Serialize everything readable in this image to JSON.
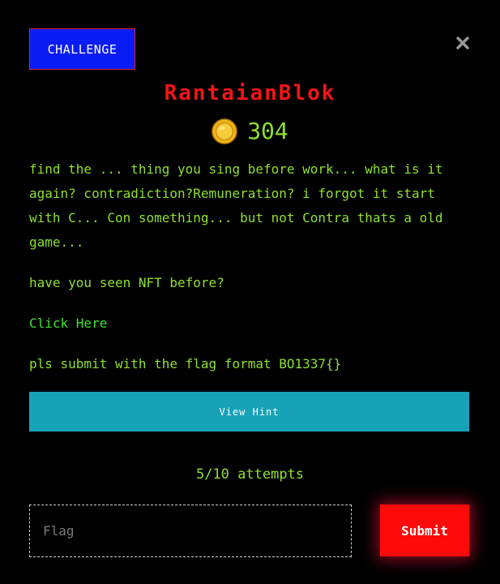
{
  "tab": {
    "label": "CHALLENGE"
  },
  "close": {
    "icon": "close-icon"
  },
  "challenge": {
    "title": "RantaianBlok",
    "points": "304",
    "coin_icon": "coin-icon",
    "description": [
      "find the ... thing you sing before work... what is it again? contradiction?Remuneration? i forgot it start with C... Con something... but not Contra thats a old game...",
      "have you seen NFT before?"
    ],
    "link_text": "Click Here",
    "flag_format_note": "pls submit with the flag format BO1337{}"
  },
  "hint": {
    "label": "View Hint"
  },
  "attempts": {
    "text": "5/10 attempts"
  },
  "form": {
    "flag_placeholder": "Flag",
    "flag_value": "",
    "submit_label": "Submit"
  },
  "colors": {
    "background": "#000000",
    "text_green": "#8ee02e",
    "title_red": "#f01616",
    "tab_blue": "#0a1cf5",
    "hint_teal": "#17a2b8",
    "submit_red": "#ff0a0a"
  }
}
